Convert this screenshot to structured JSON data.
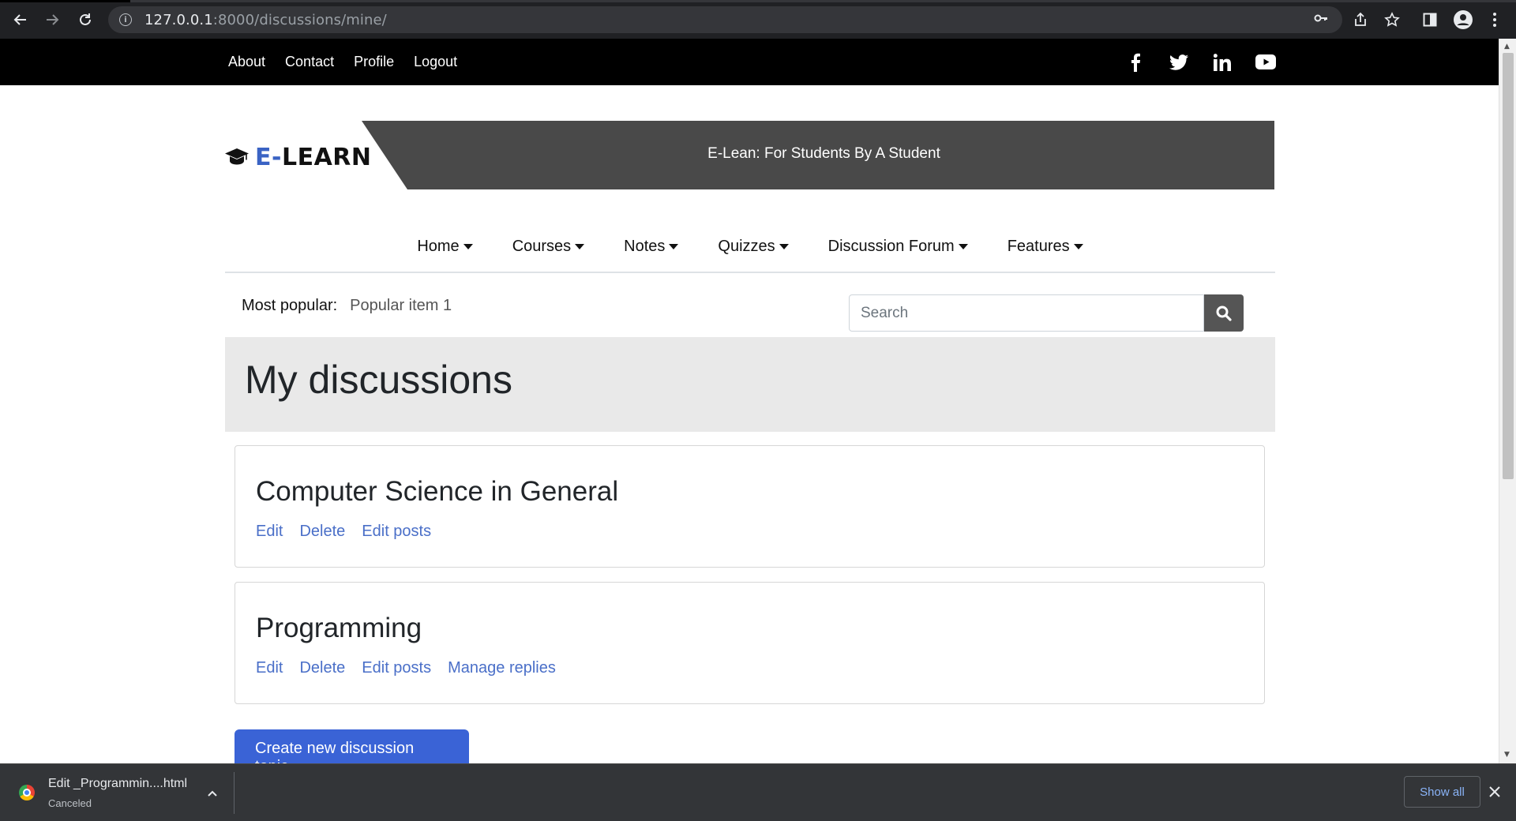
{
  "browser": {
    "url_host": "127.0.0.1",
    "url_rest": ":8000/discussions/mine/",
    "icons": [
      "back-icon",
      "forward-icon",
      "reload-icon",
      "key-icon",
      "share-icon",
      "star-icon",
      "side-panel-icon",
      "profile-icon",
      "kebab-menu-icon"
    ]
  },
  "topbar": {
    "links": [
      "About",
      "Contact",
      "Profile",
      "Logout"
    ],
    "social_icons": [
      "facebook-icon",
      "twitter-icon",
      "linkedin-icon",
      "youtube-icon"
    ]
  },
  "header": {
    "logo_accent": "E-",
    "logo_rest": "LEARN",
    "tagline": "E-Lean: For Students By A Student"
  },
  "nav": {
    "items": [
      "Home",
      "Courses",
      "Notes",
      "Quizzes",
      "Discussion Forum",
      "Features"
    ]
  },
  "popular": {
    "label": "Most popular:",
    "item": "Popular item 1"
  },
  "search": {
    "placeholder": "Search"
  },
  "page": {
    "title": "My discussions"
  },
  "discussions": [
    {
      "title": "Computer Science in General",
      "actions": [
        "Edit",
        "Delete",
        "Edit posts"
      ]
    },
    {
      "title": "Programming",
      "actions": [
        "Edit",
        "Delete",
        "Edit posts",
        "Manage replies"
      ]
    }
  ],
  "create_button": "Create new discussion topic",
  "download_bar": {
    "file_name": "Edit _Programmin....html",
    "status": "Canceled",
    "show_all": "Show all"
  },
  "colors": {
    "accent": "#3a63d6",
    "link": "#4a6fc8",
    "banner": "#494949"
  }
}
